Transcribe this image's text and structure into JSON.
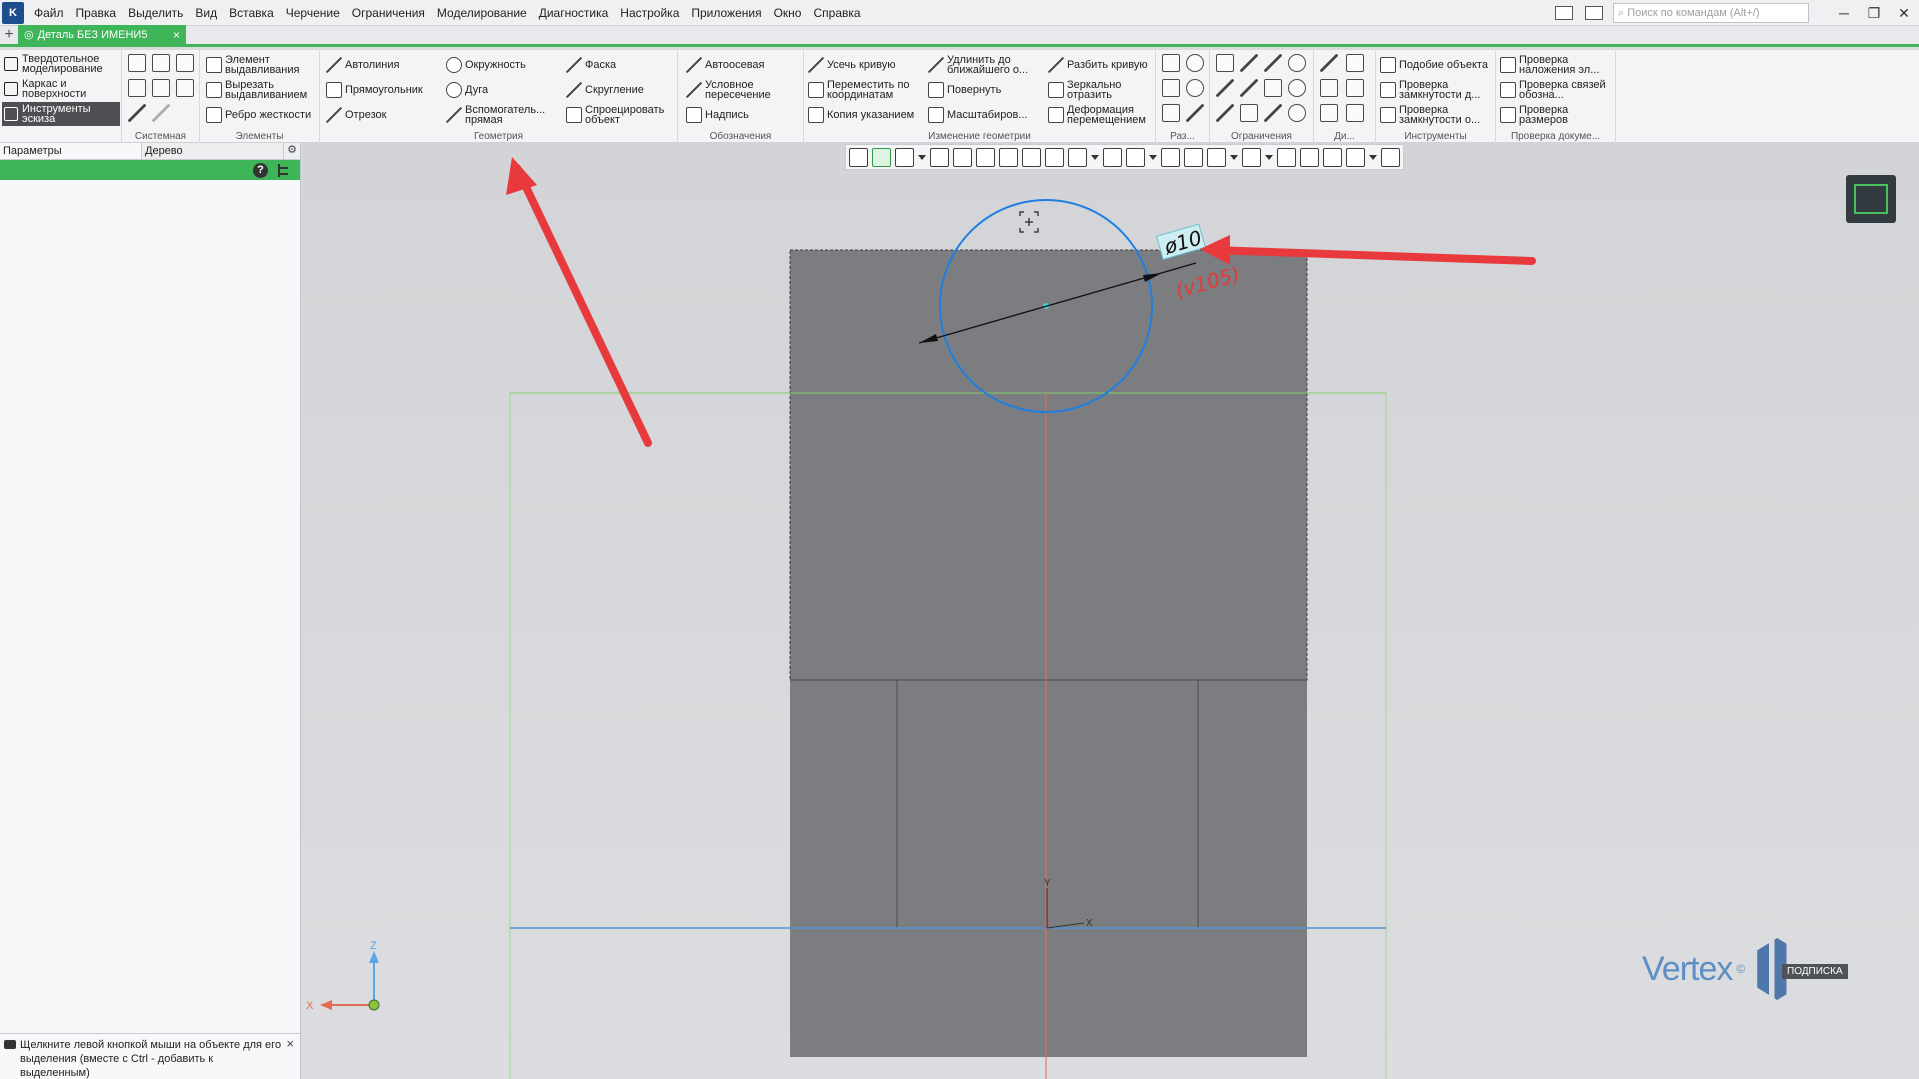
{
  "menu": {
    "items": [
      "Файл",
      "Правка",
      "Выделить",
      "Вид",
      "Вставка",
      "Черчение",
      "Ограничения",
      "Моделирование",
      "Диагностика",
      "Настройка",
      "Приложения",
      "Окно",
      "Справка"
    ],
    "search_placeholder": "Поиск по командам (Alt+/)"
  },
  "tabs": {
    "document_title": "Деталь БЕЗ ИМЕНИ5"
  },
  "ribbon": {
    "modes": [
      "Твердотельное моделирование",
      "Каркас и поверхности",
      "Инструменты эскиза"
    ],
    "groups": {
      "system": "Системная",
      "elements": "Элементы",
      "geometry": "Геометрия",
      "annotations": "Обозначения",
      "edit_geometry": "Изменение геометрии",
      "dimensions": "Раз...",
      "constraints": "Ограничения",
      "diag": "Ди...",
      "tools": "Инструменты",
      "doc_check": "Проверка докуме..."
    },
    "elements": [
      "Элемент выдавливания",
      "Вырезать выдавливанием",
      "Ребро жесткости"
    ],
    "geometry": [
      "Автолиния",
      "Прямоугольник",
      "Отрезок",
      "Окружность",
      "Дуга",
      "Вспомогатель... прямая",
      "Фаска",
      "Скругление",
      "Спроецировать объект"
    ],
    "annotations": [
      "Автоосевая",
      "Условное пересечение",
      "Надпись"
    ],
    "edit": [
      "Усечь кривую",
      "Переместить по координатам",
      "Копия указанием",
      "Удлинить до ближайшего о...",
      "Повернуть",
      "Масштабиров...",
      "Разбить кривую",
      "Зеркально отразить",
      "Деформация перемещением"
    ],
    "tools": [
      "Подобие объекта",
      "Проверка замкнутости д...",
      "Проверка замкнутости о..."
    ],
    "doc_check": [
      "Проверка наложения эл...",
      "Проверка связей обозна...",
      "Проверка размеров"
    ]
  },
  "panel": {
    "tabs": [
      "Параметры",
      "Дерево"
    ],
    "help": "?",
    "status_hint": "Щелкните левой кнопкой мыши на объекте для его выделения (вместе с Ctrl - добавить к выделенным)"
  },
  "viewport": {
    "dimension_label": "ø10",
    "dimension_annotation": "(v105)",
    "axis_labels": {
      "x": "X",
      "y": "Y",
      "z": "Z"
    },
    "watermark": "Vertex",
    "watermark_reg": "©",
    "watermark_sub": "ПОДПИСКА"
  },
  "colors": {
    "accent_green": "#3fb55a",
    "circle_blue": "#1e7fe0",
    "arrow_red": "#e8393d",
    "axis_red": "#e76a4a",
    "part_gray": "#7b7d80"
  }
}
